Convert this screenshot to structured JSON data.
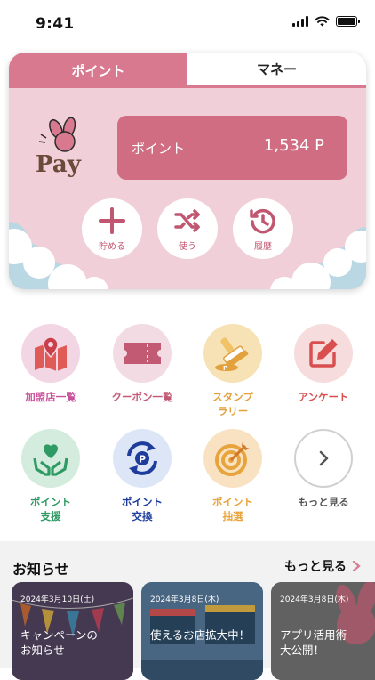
{
  "status": {
    "time": "9:41"
  },
  "wallet": {
    "tabs": [
      {
        "label": "ポイント"
      },
      {
        "label": "マネー"
      }
    ],
    "points_label": "ポイント",
    "points_value": "1,534 P",
    "logo_text": "Pay",
    "actions": [
      {
        "label": "貯める",
        "icon": "plus-icon"
      },
      {
        "label": "使う",
        "icon": "shuffle-icon"
      },
      {
        "label": "履歴",
        "icon": "history-icon"
      }
    ]
  },
  "menu": [
    {
      "label": "加盟店一覧",
      "icon": "map-pin-icon",
      "color": "#c9509b"
    },
    {
      "label": "クーポン一覧",
      "icon": "ticket-icon",
      "color": "#c25a73"
    },
    {
      "label": "スタンプ\nラリー",
      "icon": "stamp-icon",
      "color": "#e3a13d"
    },
    {
      "label": "アンケート",
      "icon": "edit-icon",
      "color": "#d94f4f"
    },
    {
      "label": "ポイント\n支援",
      "icon": "heart-hands-icon",
      "color": "#2f9a63"
    },
    {
      "label": "ポイント\n交換",
      "icon": "exchange-icon",
      "color": "#1e3c9c"
    },
    {
      "label": "ポイント\n抽選",
      "icon": "target-icon",
      "color": "#e8a43c"
    },
    {
      "label": "もっと見る",
      "icon": "chevron-right-icon",
      "color": "#555555"
    }
  ],
  "news": {
    "title": "お知らせ",
    "more_label": "もっと見る",
    "items": [
      {
        "date": "2024年3月10日(土)",
        "text": "キャンペーンの\nお知らせ"
      },
      {
        "date": "2024年3月8日(木)",
        "text": "使えるお店拡大中！"
      },
      {
        "date": "2024年3月8日(木)",
        "text": "アプリ活用術\n大公開！"
      }
    ]
  }
}
